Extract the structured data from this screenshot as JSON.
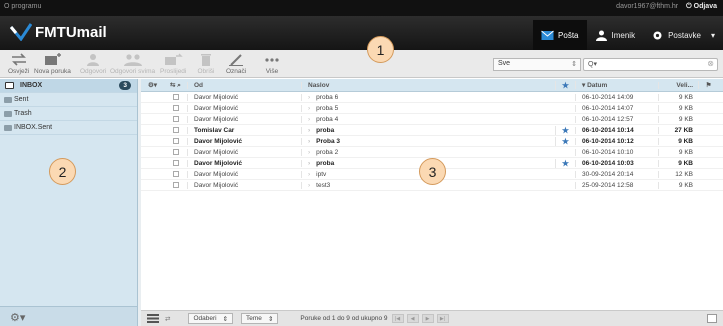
{
  "topbar": {
    "app_link": "O programu",
    "user": "davor1967@fthm.hr",
    "logout": "Odjava"
  },
  "header": {
    "logo": "FMTUmail",
    "nav": [
      {
        "label": "Pošta",
        "icon": "mail-icon",
        "active": true
      },
      {
        "label": "Imenik",
        "icon": "person-icon",
        "active": false
      },
      {
        "label": "Postavke",
        "icon": "gear-icon",
        "active": false
      }
    ]
  },
  "toolbar": {
    "buttons": [
      {
        "label": "Osvježi",
        "icon": "refresh-icon"
      },
      {
        "label": "Nova poruka",
        "icon": "compose-icon"
      },
      {
        "label": "Odgovori",
        "icon": "reply-icon"
      },
      {
        "label": "Odgovori svima",
        "icon": "reply-all-icon"
      },
      {
        "label": "Proslijedi",
        "icon": "forward-icon"
      },
      {
        "label": "Obriši",
        "icon": "trash-icon"
      },
      {
        "label": "Označi",
        "icon": "mark-icon"
      },
      {
        "label": "Više",
        "icon": "more-icon"
      }
    ],
    "filter": "Sve",
    "search_placeholder": "Q▾"
  },
  "folders": [
    {
      "name": "INBOX",
      "count": "3"
    },
    {
      "name": "Sent"
    },
    {
      "name": "Trash"
    },
    {
      "name": "INBOX.Sent"
    }
  ],
  "columns": {
    "from": "Od",
    "subject": "Naslov",
    "date": "Datum",
    "size": "Veli..."
  },
  "messages": [
    {
      "from": "Davor Mijolović",
      "subject": "proba 6",
      "date": "06-10-2014 14:09",
      "size": "9 KB",
      "unread": false,
      "starred": false
    },
    {
      "from": "Davor Mijolović",
      "subject": "proba 5",
      "date": "06-10-2014 14:07",
      "size": "9 KB",
      "unread": false,
      "starred": false
    },
    {
      "from": "Davor Mijolović",
      "subject": "proba 4",
      "date": "06-10-2014 12:57",
      "size": "9 KB",
      "unread": false,
      "starred": false
    },
    {
      "from": "Tomislav Car",
      "subject": "proba",
      "date": "06-10-2014 10:14",
      "size": "27 KB",
      "unread": true,
      "starred": true
    },
    {
      "from": "Davor Mijolović",
      "subject": "Proba 3",
      "date": "06-10-2014 10:12",
      "size": "9 KB",
      "unread": true,
      "starred": true
    },
    {
      "from": "Davor Mijolović",
      "subject": "proba 2",
      "date": "06-10-2014 10:10",
      "size": "9 KB",
      "unread": false,
      "starred": false
    },
    {
      "from": "Davor Mijolović",
      "subject": "proba",
      "date": "06-10-2014 10:03",
      "size": "9 KB",
      "unread": true,
      "starred": true
    },
    {
      "from": "Davor Mijolović",
      "subject": "iptv",
      "date": "30-09-2014 20:14",
      "size": "12 KB",
      "unread": false,
      "starred": false
    },
    {
      "from": "Davor Mijolović",
      "subject": "test3",
      "date": "25-09-2014 12:58",
      "size": "9 KB",
      "unread": false,
      "starred": false
    }
  ],
  "footer": {
    "select_label": "Odaberi",
    "threads_label": "Teme",
    "status": "Poruke od 1 do 9 od ukupno 9"
  },
  "callouts": [
    "1",
    "2",
    "3"
  ],
  "colors": {
    "accent": "#2b6fb0",
    "sidebar": "#d5e6f0",
    "star": "#3b78b8"
  }
}
